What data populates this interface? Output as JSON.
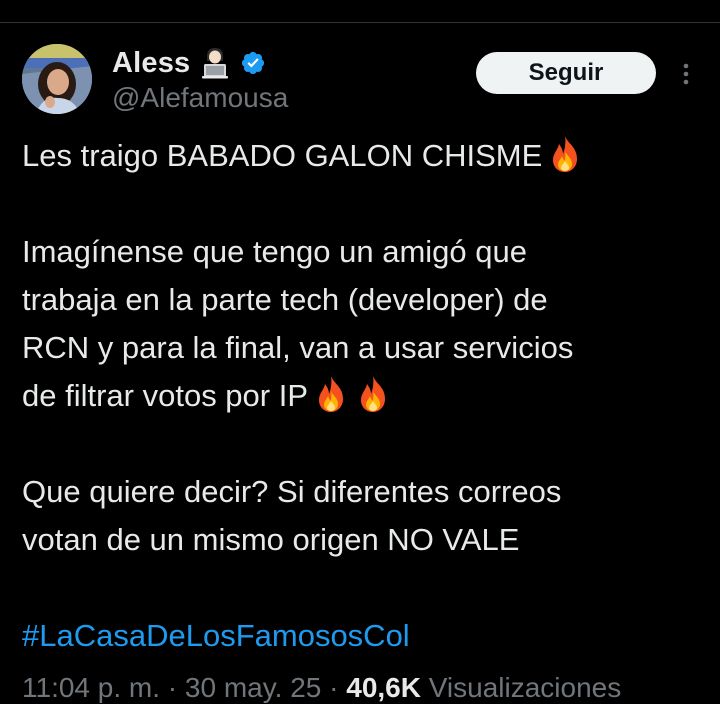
{
  "author": {
    "display_name": "Aless",
    "handle": "@Alefamousa",
    "verified": true
  },
  "actions": {
    "follow_label": "Seguir"
  },
  "tweet": {
    "line1": "Les traigo BABADO GALON CHISME",
    "line2": "Imagínense que tengo un amigó que",
    "line3": "trabaja en la parte tech (developer) de",
    "line4": "RCN y para la final, van a usar servicios",
    "line5": "de filtrar votos por IP",
    "line6": "Que quiere decir? Si diferentes correos",
    "line7": "votan de un mismo origen NO VALE",
    "hashtag": "#LaCasaDeLosFamososCol"
  },
  "meta": {
    "time": "11:04 p. m.",
    "separator": "·",
    "date": "30 may. 25",
    "views_count": "40,6K",
    "views_label": "Visualizaciones"
  },
  "colors": {
    "background": "#000000",
    "text": "#e7e9ea",
    "muted": "#71767b",
    "link": "#1d9bf0",
    "verified": "#1d9bf0"
  },
  "icons": {
    "verified": "verified-badge-icon",
    "more": "more-horizontal-icon",
    "fire": "fire-emoji-icon",
    "name_emoji": "person-at-laptop-emoji-icon"
  }
}
